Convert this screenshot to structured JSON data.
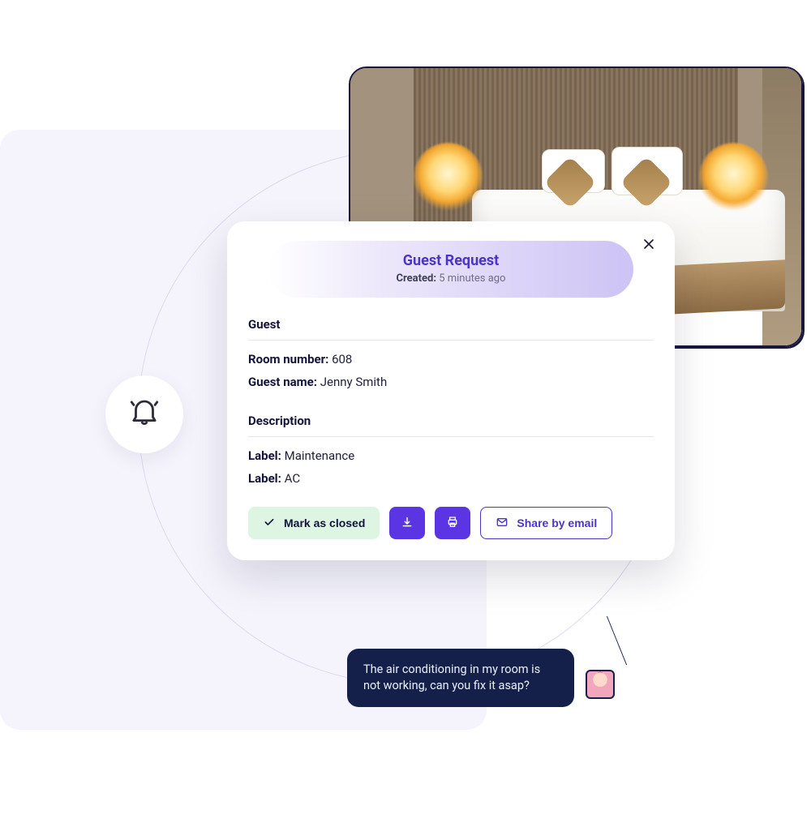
{
  "card": {
    "title": "Guest Request",
    "created_label": "Created:",
    "created_value": "5 minutes ago",
    "sections": {
      "guest": {
        "heading": "Guest",
        "room_label": "Room number:",
        "room_value": "608",
        "name_label": "Guest name:",
        "name_value": "Jenny Smith"
      },
      "description": {
        "heading": "Description",
        "label1_key": "Label:",
        "label1_val": "Maintenance",
        "label2_key": "Label:",
        "label2_val": "AC"
      }
    },
    "actions": {
      "close_label": "Mark as closed",
      "share_label": "Share by email"
    }
  },
  "chat": {
    "message": "The air conditioning in my room is not working, can you fix it asap?"
  }
}
